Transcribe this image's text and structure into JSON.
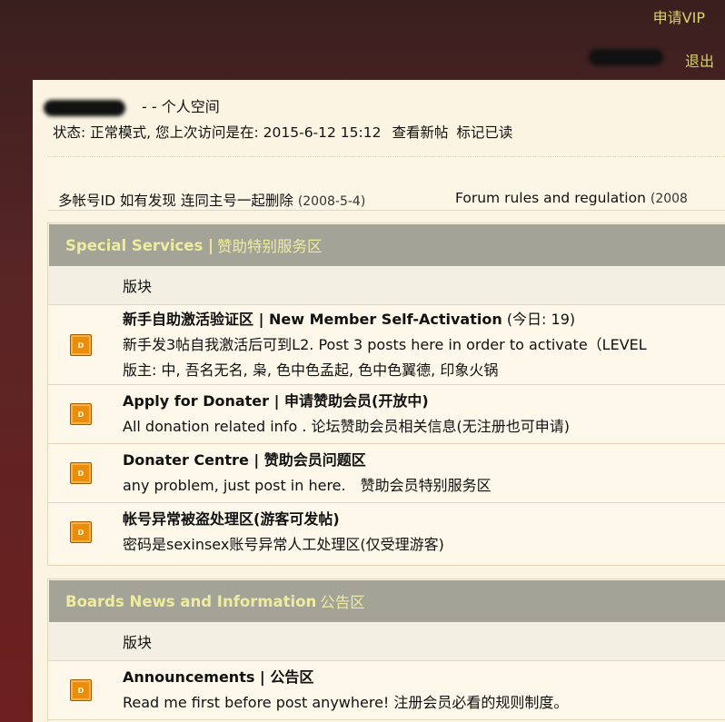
{
  "header": {
    "vip_link": "申请VIP",
    "logout_link": "退出"
  },
  "user": {
    "space_suffix": "- - 个人空间",
    "status_prefix": "状态: 正常模式, 您上次访问是在: 2015-6-12 15:12",
    "view_new": "查看新帖",
    "mark_read": "标记已读"
  },
  "notices": [
    {
      "title": "多帐号ID 如有发现 连同主号一起删除",
      "date": "(2008-5-4)"
    },
    {
      "title": "Forum rules and regulation",
      "date": "(2008"
    }
  ],
  "sections": [
    {
      "title_en": "Special Services |",
      "title_cn": "赞助特别服务区",
      "column_header": "版块",
      "forums": [
        {
          "icon": "D",
          "title": "新手自助激活验证区 | New Member Self-Activation",
          "today": "(今日: 19)",
          "desc": "新手发3帖自我激活后可到L2. Post 3 posts here in order to activate（LEVEL",
          "mods": "版主: 中, 吾名无名, 枭, 色中色孟起, 色中色翼德, 印象火锅"
        },
        {
          "icon": "D",
          "title": "Apply for Donater | 申请赞助会员(开放中)",
          "desc": "All donation related info . 论坛赞助会员相关信息(无注册也可申请)"
        },
        {
          "icon": "D",
          "title": "Donater Centre | 赞助会员问题区",
          "desc": "any problem, just post in here.　赞助会员特别服务区"
        },
        {
          "icon": "D",
          "title": "帐号异常被盗处理区(游客可发帖)",
          "desc": "密码是sexinsex账号异常人工处理区(仅受理游客)"
        }
      ]
    },
    {
      "title_en": "Boards News and Information",
      "title_cn": "公告区",
      "column_header": "版块",
      "forums": [
        {
          "icon": "D",
          "title": "Announcements | 公告区",
          "desc": "Read me first before post anywhere! 注册会员必看的规则制度。"
        }
      ]
    }
  ],
  "colors": {
    "header_bg": "#a3a398",
    "header_text": "#eeec9e",
    "page_bg": "#fbf4e2",
    "link_yellow": "#d8d36a",
    "forum_icon": "#e98d0a"
  }
}
